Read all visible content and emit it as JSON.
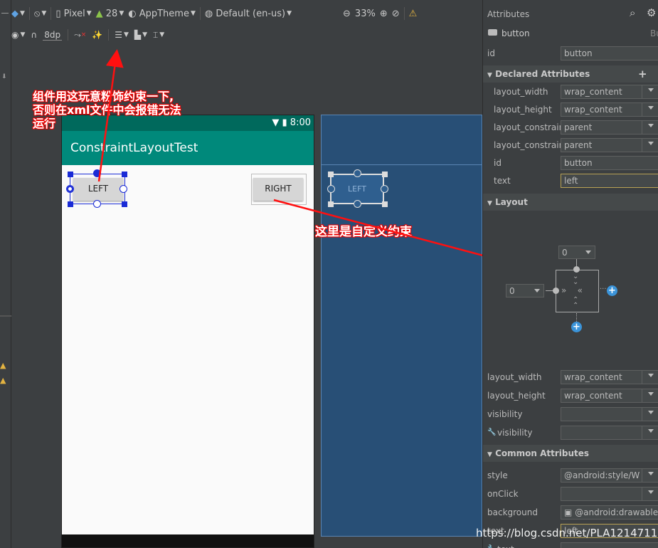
{
  "toolbar": {
    "device": "Pixel",
    "api_level": "28",
    "theme": "AppTheme",
    "locale": "Default (en-us)",
    "zoom": "33%",
    "margin": "8dp"
  },
  "phone": {
    "time": "8:00",
    "app_title": "ConstraintLayoutTest",
    "left_button": "LEFT",
    "right_button": "RIGHT"
  },
  "blueprint": {
    "left_button": "LEFT"
  },
  "annotations": {
    "top_note_1": "组件用这玩意粉饰约束一下,",
    "top_note_2": "否则在xml文件中会报错无法",
    "top_note_3": "运行",
    "custom_note": "这里是自定义约束"
  },
  "attributes": {
    "header": "Attributes",
    "component": "button",
    "component_suffix": "Bu",
    "id_label": "id",
    "id_value": "button",
    "declared_section": "Declared Attributes",
    "declared": [
      {
        "label": "layout_width",
        "value": "wrap_content"
      },
      {
        "label": "layout_height",
        "value": "wrap_content"
      },
      {
        "label": "layout_constraint",
        "value": "parent"
      },
      {
        "label": "layout_constraint",
        "value": "parent"
      },
      {
        "label": "id",
        "value": "button"
      },
      {
        "label": "text",
        "value": "left"
      }
    ],
    "layout_section": "Layout",
    "margin_top": "0",
    "margin_left": "0",
    "layout_rows": [
      {
        "label": "layout_width",
        "value": "wrap_content"
      },
      {
        "label": "layout_height",
        "value": "wrap_content"
      },
      {
        "label": "visibility",
        "value": ""
      },
      {
        "label": "visibility",
        "value": ""
      }
    ],
    "common_section": "Common Attributes",
    "common_rows": [
      {
        "label": "style",
        "value": "@android:style/W"
      },
      {
        "label": "onClick",
        "value": ""
      },
      {
        "label": "background",
        "value": "@android:drawable"
      },
      {
        "label": "text",
        "value": "left"
      },
      {
        "label": "text",
        "value": ""
      }
    ]
  },
  "watermark": "https://blog.csdn.net/PLA12147111"
}
